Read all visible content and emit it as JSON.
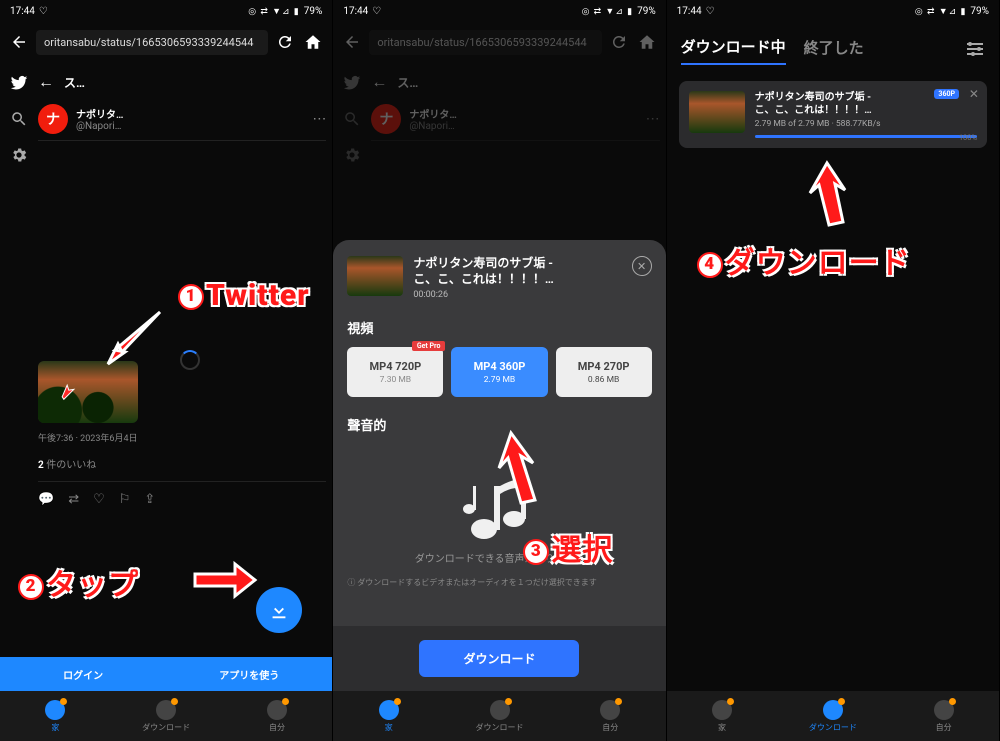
{
  "status": {
    "time": "17:44",
    "battery": "79%",
    "icons": "◎ ⇄ ▼⊿ ▮"
  },
  "url": "oritansabu/status/1665306593339244544",
  "tw": {
    "head": "ス…",
    "author_name": "ナポリタ…",
    "author_handle": "@Napori…",
    "timestamp": "午後7:36 · 2023年6月4日",
    "likes_count": "2",
    "likes_label": " 件のいいね"
  },
  "login": {
    "login": "ログイン",
    "app": "アプリを使う"
  },
  "nav": {
    "home": "家",
    "download": "ダウンロード",
    "me": "自分"
  },
  "modal": {
    "title1": "ナポリタン寿司のサブ垢 -",
    "title2": "こ、こ、これは！！！！…",
    "duration": "00:00:26",
    "video_label": "視頻",
    "audio_label": "聲音的",
    "formats": [
      {
        "label": "MP4 720P",
        "size": "7.30 MB",
        "pro": true
      },
      {
        "label": "MP4 360P",
        "size": "2.79 MB",
        "selected": true
      },
      {
        "label": "MP4 270P",
        "size": "0.86 MB"
      }
    ],
    "pro_badge": "Get Pro",
    "audio_empty": "ダウンロードできる音声がありません",
    "hint": "ⓘ ダウンロードするビデオまたはオーディオを１つだけ選択できます",
    "button": "ダウンロード"
  },
  "tabs": {
    "downloading": "ダウンロード中",
    "finished": "終了した"
  },
  "dl": {
    "title1": "ナポリタン寿司のサブ垢 -",
    "title2": "こ、こ、これは！！！！…",
    "stats": "2.79 MB of 2.79 MB · 588.77KB/s",
    "badge": "360P",
    "pct": "100%"
  },
  "ann": {
    "a1": "Twitter",
    "a2": "タップ",
    "a3": "選択",
    "a4": "ダウンロード"
  }
}
